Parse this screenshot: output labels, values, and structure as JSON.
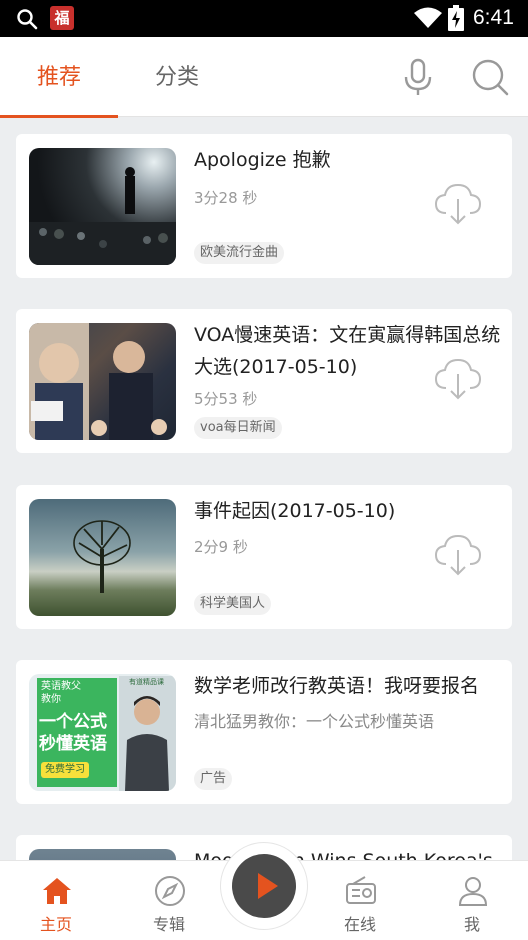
{
  "status_bar": {
    "time": "6:41",
    "app_icon_glyph": "福"
  },
  "top_nav": {
    "tabs": [
      {
        "label": "推荐",
        "active": true
      },
      {
        "label": "分类",
        "active": false
      }
    ],
    "accent_color": "#e4531f"
  },
  "feed": {
    "items": [
      {
        "title": "Apologize 抱歉",
        "duration": "3分28 秒",
        "tag": "欧美流行金曲"
      },
      {
        "title": "VOA慢速英语：文在寅赢得韩国总统大选(2017-05-10)",
        "duration": "5分53 秒",
        "tag": "voa每日新闻"
      },
      {
        "title": " 事件起因(2017-05-10)",
        "duration": "2分9 秒",
        "tag": "科学美国人"
      },
      {
        "title": "数学老师改行教英语！我呀要报名",
        "subtitle": "清北猛男教你：一个公式秒懂英语",
        "tag": "广告",
        "ad_image": {
          "top_text": "英语教父",
          "top_text2": "教你",
          "main_line1": "一个公式",
          "main_line2": "秒懂英语",
          "button": "免费学习",
          "badge": "有道精品课"
        }
      },
      {
        "title": "Moon Jae-in Wins South Korea's"
      }
    ]
  },
  "bottom_nav": {
    "items": [
      {
        "label": "主页",
        "icon": "home-icon",
        "active": true
      },
      {
        "label": "专辑",
        "icon": "compass-icon",
        "active": false
      },
      {
        "label": "在线",
        "icon": "radio-icon",
        "active": false
      },
      {
        "label": "我",
        "icon": "person-icon",
        "active": false
      }
    ]
  }
}
